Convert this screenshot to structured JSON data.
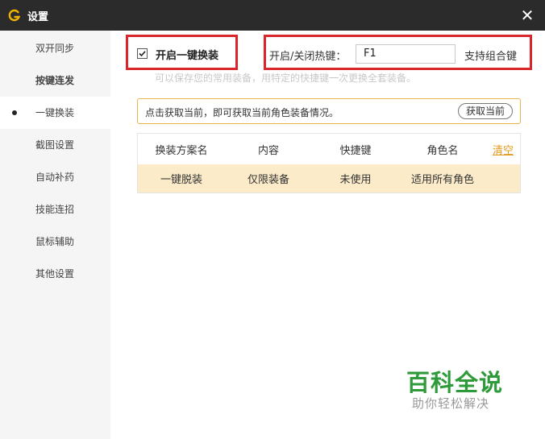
{
  "window": {
    "title": "设置"
  },
  "sidebar": {
    "items": [
      {
        "label": "双开同步"
      },
      {
        "label": "按键连发"
      },
      {
        "label": "一键换装"
      },
      {
        "label": "截图设置"
      },
      {
        "label": "自动补药"
      },
      {
        "label": "技能连招"
      },
      {
        "label": "鼠标辅助"
      },
      {
        "label": "其他设置"
      }
    ],
    "active_index": 2
  },
  "settings": {
    "enable_label": "开启一键换装",
    "enable_checked": true,
    "hotkey_label": "开启/关闭热键：",
    "hotkey_value": "F1",
    "combo_label": "支持组合键",
    "hint": "可以保存您的常用装备，用特定的快捷键一次更换全套装备。"
  },
  "info": {
    "text": "点击获取当前，即可获取当前角色装备情况。",
    "button": "获取当前"
  },
  "table": {
    "headers": [
      "换装方案名",
      "内容",
      "快捷键",
      "角色名"
    ],
    "clear_label": "清空",
    "rows": [
      [
        "一键脱装",
        "仅限装备",
        "未使用",
        "适用所有角色"
      ]
    ]
  },
  "watermark": {
    "big": "百科全说",
    "small": "助你轻松解决"
  },
  "colors": {
    "accent": "#e09a1c",
    "highlight": "#d9252c",
    "row": "#fcebc9",
    "titlebar": "#2b2b2b"
  }
}
